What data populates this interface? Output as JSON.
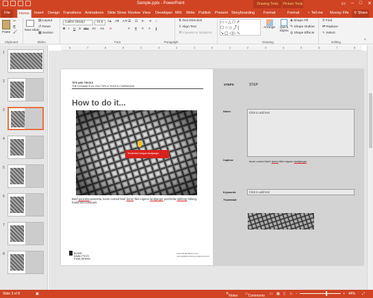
{
  "window": {
    "title": "Sample.pptx - PowerPoint",
    "ctx_drawing": "Drawing Tools",
    "ctx_picture": "Picture Tools"
  },
  "tabs": [
    "File",
    "Home",
    "Insert",
    "Design",
    "Transitions",
    "Animations",
    "Slide Show",
    "Review",
    "View",
    "Developer",
    "MIX",
    "Write",
    "Publish",
    "Present",
    "Storyboarding",
    "Format",
    "Format"
  ],
  "tell_me": "Tell me",
  "user": "Murray Fife",
  "share": "Share",
  "ribbon": {
    "paste": "Paste",
    "new_slide": "New Slide",
    "layout": "Layout",
    "reset": "Reset",
    "section": "Section",
    "font_name": "Calibri (Body)",
    "font_size": "10.5",
    "text_direction": "Text Direction",
    "align_text": "Align Text",
    "convert_smartart": "Convert to SmartArt",
    "arrange": "Arrange",
    "quick_styles": "Quick Styles",
    "shape_fill": "Shape Fill",
    "shape_outline": "Shape Outline",
    "shape_effects": "Shape Effects",
    "find": "Find",
    "replace": "Replace",
    "select": "Select",
    "groups": [
      "Clipboard",
      "Slides",
      "Font",
      "Paragraph",
      "Drawing",
      "Editing"
    ]
  },
  "ruler_marks": [
    "8",
    "7",
    "6",
    "5",
    "4",
    "3",
    "2",
    "1",
    "0",
    "1",
    "2",
    "3",
    "4",
    "5",
    "6",
    "7",
    "8"
  ],
  "thumb_numbers": [
    "1",
    "2",
    "3",
    "4",
    "5",
    "6",
    "7",
    "8"
  ],
  "slide": {
    "header_line1": "TIPS AND TRICKS",
    "header_line2": "THE DYNAMICS AX 2012 TIPS & TRICKS COMPANION",
    "heading": "How to do it...",
    "photo_label": "Tenderloin tongue landjaeger",
    "caption_pre": "Beef ",
    "caption_u1": "pancetta",
    "caption_mid1": " pancetta, kevin corned beef ",
    "caption_u2": "doner",
    "caption_mid2": " filet mignon ",
    "caption_u3": "landjaeger",
    "caption_mid3": " porchetta ",
    "caption_u4": "tabletop",
    "caption_end": " biltong frankfurter pastrami.",
    "logo": "BLIND ANALYTICS PUBLISHING",
    "footnote": "www.blindanalytics.com murray@dynamicscompanions.com"
  },
  "notes_panel": {
    "steps": "STEPS",
    "step": "STEP",
    "notes_label": "Notes:",
    "notes_placeholder": "Click to add text",
    "caption_label": "Caption:",
    "caption_pre": "kevin corned beef ",
    "caption_u1": "doner",
    "caption_mid": " filet mignon ",
    "caption_u2": "landjaeger",
    "keywords_label": "Keywords:",
    "keywords_placeholder": "Click to add text",
    "thumbnail_label": "Thumbnail:"
  },
  "status": {
    "slide_of": "Slide 3 of 8",
    "notes": "Notes",
    "comments": "Comments",
    "zoom": "44%"
  },
  "colors": {
    "accent": "#d04423",
    "ribbon_bg": "#f3f3f3"
  }
}
